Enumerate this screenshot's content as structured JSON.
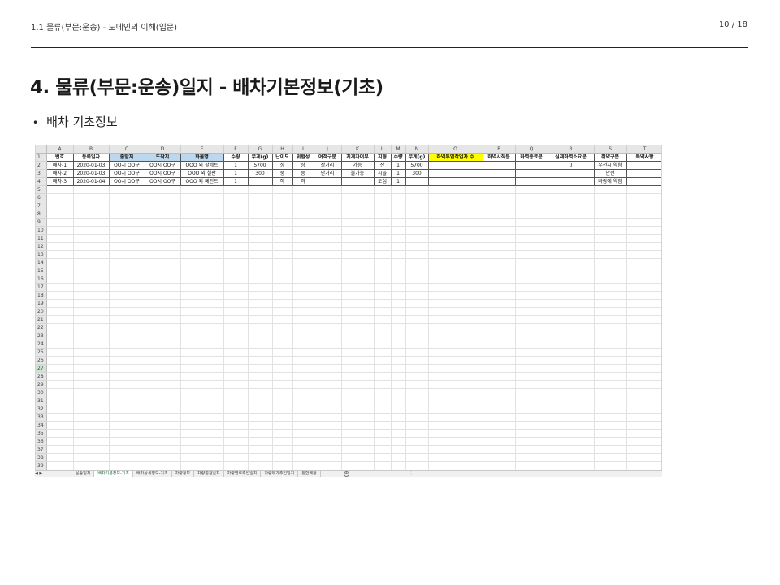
{
  "header": {
    "breadcrumb": "1.1 물류(부문:운송) - 도메인의 이해(입문)",
    "page": "10 / 18"
  },
  "title": "4. 물류(부문:운송)일지 - 배차기본정보(기초)",
  "bullet": "배차 기초정보",
  "spreadsheet": {
    "columns": [
      "A",
      "B",
      "C",
      "D",
      "E",
      "F",
      "G",
      "H",
      "I",
      "J",
      "K",
      "L",
      "M",
      "N",
      "O",
      "P",
      "Q",
      "R",
      "S",
      "T"
    ],
    "header_row": [
      "번호",
      "등록일자",
      "출발지",
      "도착지",
      "화물명",
      "수량",
      "무게(g)",
      "난이도",
      "위험성",
      "여객구분",
      "지게차여부",
      "지형",
      "수량",
      "무게(g)",
      "하역투입작업자 수",
      "하역시작분",
      "하역종료분",
      "실제하역소요분",
      "취약구분",
      "특약사항"
    ],
    "rows": [
      [
        "배차-1",
        "2020-01-03",
        "OO시 OO구",
        "OO시 OO구",
        "OOO 외 팔레트",
        "1",
        "5700",
        "상",
        "상",
        "장거리",
        "가능",
        "산",
        "1",
        "5700",
        "",
        "",
        "",
        "0",
        "우천시 약함",
        ""
      ],
      [
        "배차-2",
        "2020-01-03",
        "OO시 OO구",
        "OO시 OO구",
        "OOO 외 철판",
        "1",
        "300",
        "중",
        "중",
        "단거리",
        "불가능",
        "시골",
        "1",
        "300",
        "",
        "",
        "",
        "",
        "안전",
        ""
      ],
      [
        "배차-3",
        "2020-01-04",
        "OO시 OO구",
        "OO시 OO구",
        "OOO 외 페인트",
        "1",
        "",
        "하",
        "하",
        "",
        "",
        "도심",
        "1",
        "",
        "",
        "",
        "",
        "",
        "바람에 약함",
        ""
      ]
    ],
    "row_numbers": [
      "1",
      "2",
      "3",
      "4",
      "5",
      "6",
      "7",
      "8",
      "9",
      "10",
      "11",
      "12",
      "13",
      "14",
      "15",
      "16",
      "17",
      "18",
      "19",
      "20",
      "21",
      "22",
      "23",
      "24",
      "25",
      "26",
      "27",
      "28",
      "29",
      "30",
      "31",
      "32",
      "33",
      "34",
      "35",
      "36",
      "37",
      "38",
      "39"
    ],
    "selected_row": "27",
    "highlight": {
      "blue_columns": [
        "C",
        "D",
        "E"
      ],
      "yellow_column": "O",
      "blue_hex": "#bdd7ee",
      "yellow_hex": "#ffff00"
    },
    "tabs": [
      "운송일지",
      "배차기본정보-기초",
      "배차상세정보-기초",
      "차량정보",
      "차량점검일지",
      "차량연료주입일지",
      "차량부가주입일지",
      "통합계정"
    ],
    "active_tab": "배차기본정보-기초"
  }
}
